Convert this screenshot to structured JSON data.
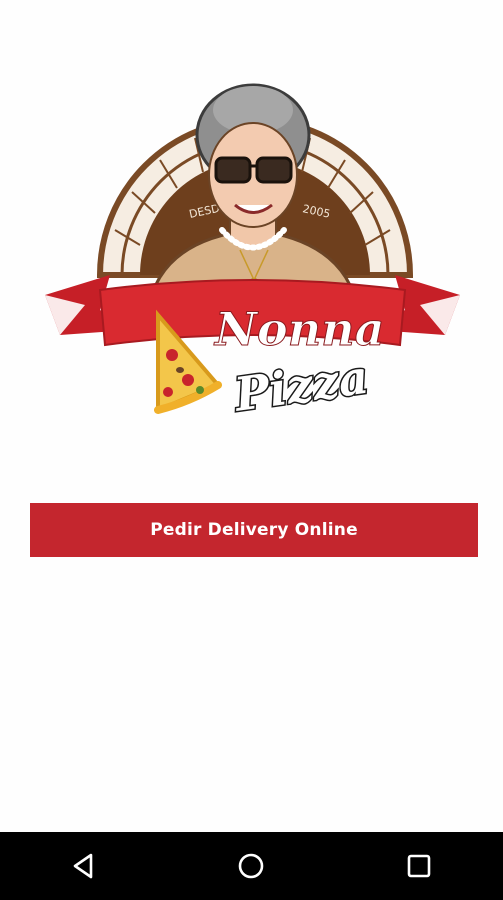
{
  "logo": {
    "name_line1": "Nonna",
    "name_line2": "Pizza",
    "since_left": "DESDE",
    "since_right": "2005",
    "colors": {
      "oven_brown": "#7a4a25",
      "banner_red": "#d92a30",
      "crust_yellow": "#f0b02a"
    }
  },
  "cta": {
    "label": "Pedir Delivery Online",
    "color": "#c4262e"
  },
  "navigation_bar": {
    "back_icon": "triangle-back-icon",
    "home_icon": "circle-home-icon",
    "recents_icon": "square-recents-icon"
  }
}
